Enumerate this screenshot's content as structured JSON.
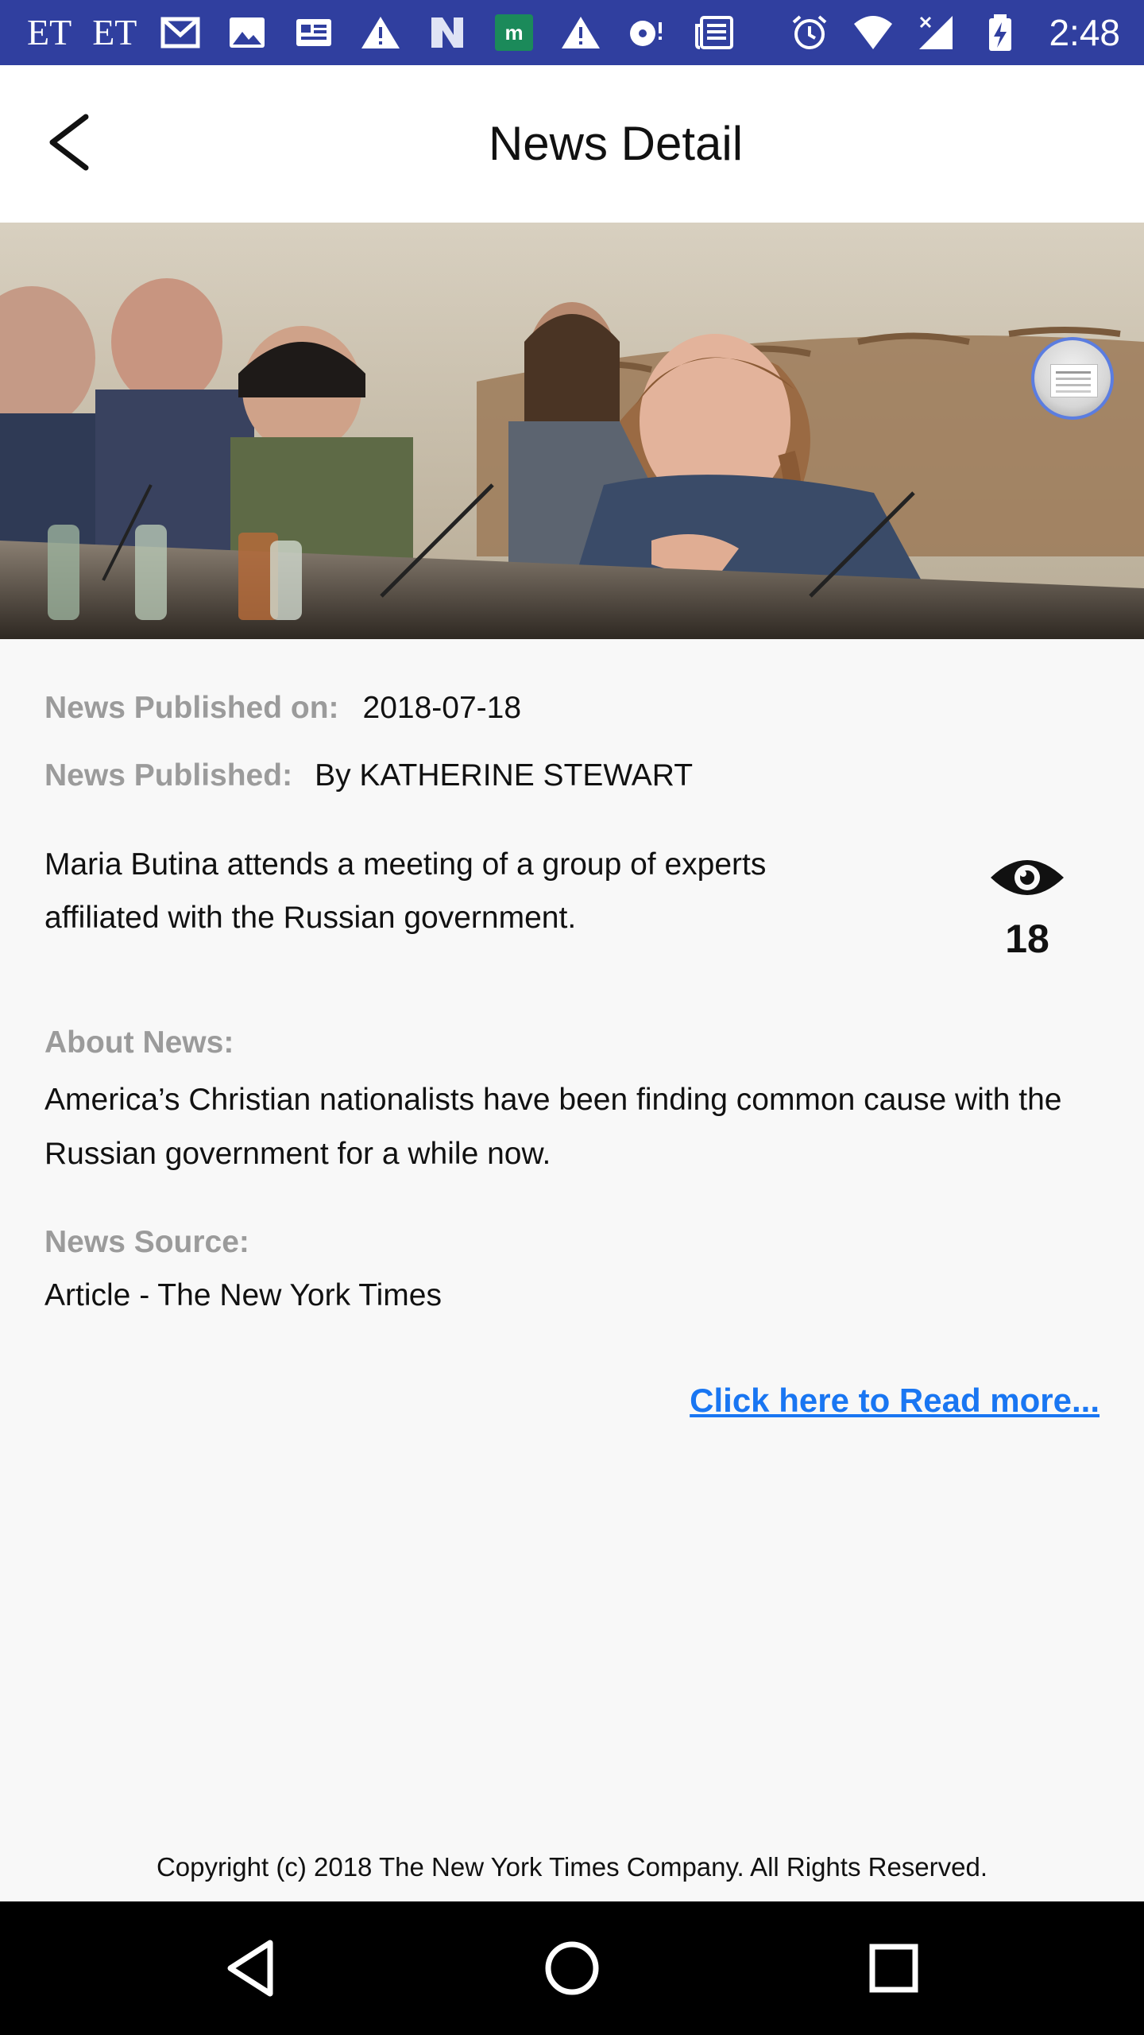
{
  "status_bar": {
    "left_texts": [
      "ET",
      "ET"
    ],
    "time": "2:48",
    "icons_left": [
      "gmail-icon",
      "image-icon",
      "news-card-icon",
      "warning-icon",
      "n-icon",
      "m-app-icon",
      "warning-icon",
      "podcast-icon",
      "newspaper-icon"
    ],
    "icons_right": [
      "alarm-icon",
      "wifi-icon",
      "signal-icon",
      "battery-icon"
    ]
  },
  "app_bar": {
    "title": "News Detail"
  },
  "meta": {
    "published_on_label": "News Published on:",
    "published_on_value": "2018-07-18",
    "published_by_label": "News Published:",
    "published_by_value": "By KATHERINE STEWART"
  },
  "caption": "Maria Butina attends a meeting of a group of experts affiliated with the Russian government.",
  "views": {
    "count": "18"
  },
  "about": {
    "label": "About News:",
    "text": "America’s Christian nationalists have been finding common cause with the Russian government for a while now."
  },
  "source": {
    "label": "News Source:",
    "text": "Article - The New York Times"
  },
  "read_more": "Click here to Read more...",
  "copyright": "Copyright (c) 2018 The New York Times Company.  All Rights Reserved.",
  "colors": {
    "status_bar": "#303f9f",
    "link": "#1976f2",
    "label": "#9b9b9b"
  }
}
